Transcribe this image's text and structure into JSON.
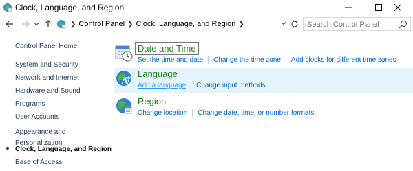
{
  "window": {
    "title": "Clock, Language, and Region"
  },
  "address": {
    "crumbs": [
      "Control Panel",
      "Clock, Language, and Region"
    ]
  },
  "search": {
    "placeholder": "Search Control Panel"
  },
  "sidebar": {
    "home": "Control Panel Home",
    "items": [
      "System and Security",
      "Network and Internet",
      "Hardware and Sound",
      "Programs",
      "User Accounts",
      "Appearance and Personalization",
      "Clock, Language, and Region",
      "Ease of Access"
    ],
    "appearance_line1": "Appearance and",
    "appearance_line2": "Personalization"
  },
  "categories": [
    {
      "title": "Date and Time",
      "links": [
        "Set the time and date",
        "Change the time zone",
        "Add clocks for different time zones"
      ],
      "icon": "clock-calendar-icon"
    },
    {
      "title": "Language",
      "links": [
        "Add a language",
        "Change input methods"
      ],
      "icon": "language-globe-icon"
    },
    {
      "title": "Region",
      "links": [
        "Change location",
        "Change date, time, or number formats"
      ],
      "icon": "region-globe-icon"
    }
  ],
  "colors": {
    "link": "#0066cc",
    "category_title": "#1e7f1e",
    "nav_text": "#1e395b",
    "hover_bg": "#e5f3fb"
  }
}
